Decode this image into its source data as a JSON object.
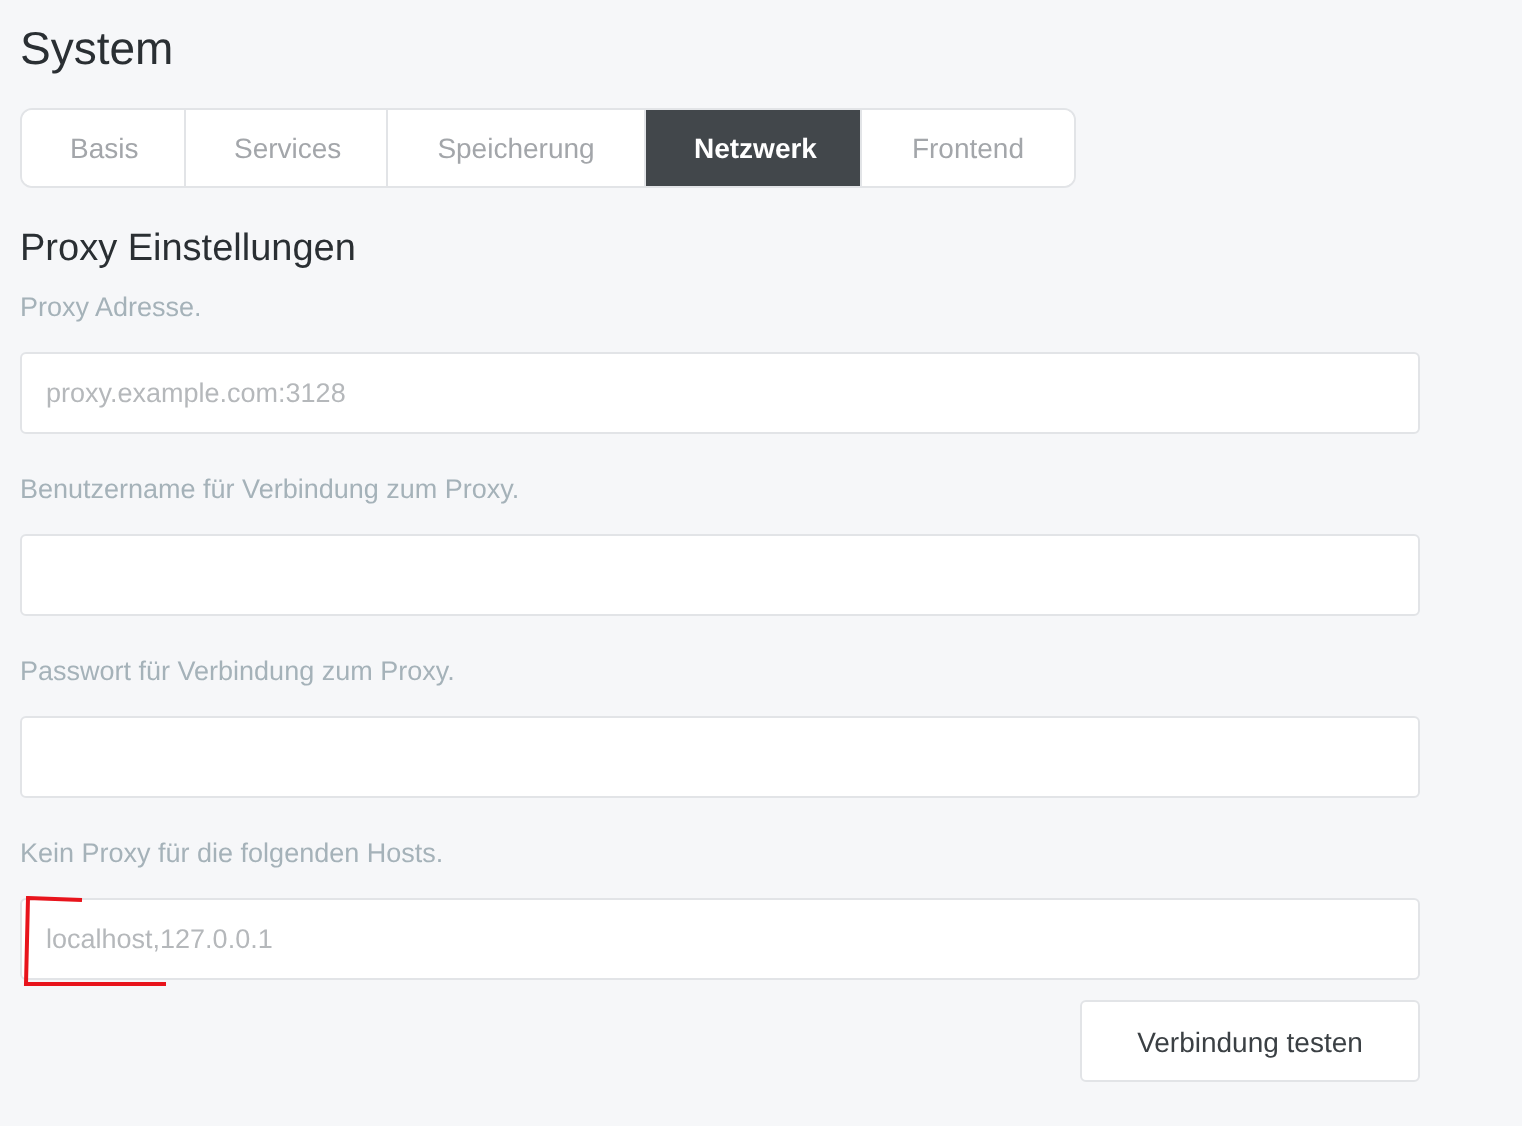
{
  "title": "System",
  "tabs": [
    {
      "label": "Basis",
      "selected": false
    },
    {
      "label": "Services",
      "selected": false
    },
    {
      "label": "Speicherung",
      "selected": false
    },
    {
      "label": "Netzwerk",
      "selected": true
    },
    {
      "label": "Frontend",
      "selected": false
    }
  ],
  "section": {
    "heading": "Proxy Einstellungen",
    "fields": [
      {
        "label": "Proxy Adresse.",
        "placeholder": "proxy.example.com:3128"
      },
      {
        "label": "Benutzername für Verbindung zum Proxy."
      },
      {
        "label": "Passwort für Verbindung zum Proxy."
      },
      {
        "label": "Kein Proxy für die folgenden Hosts.",
        "placeholder": "localhost,127.0.0.1"
      }
    ],
    "button": "Verbindung testen"
  }
}
